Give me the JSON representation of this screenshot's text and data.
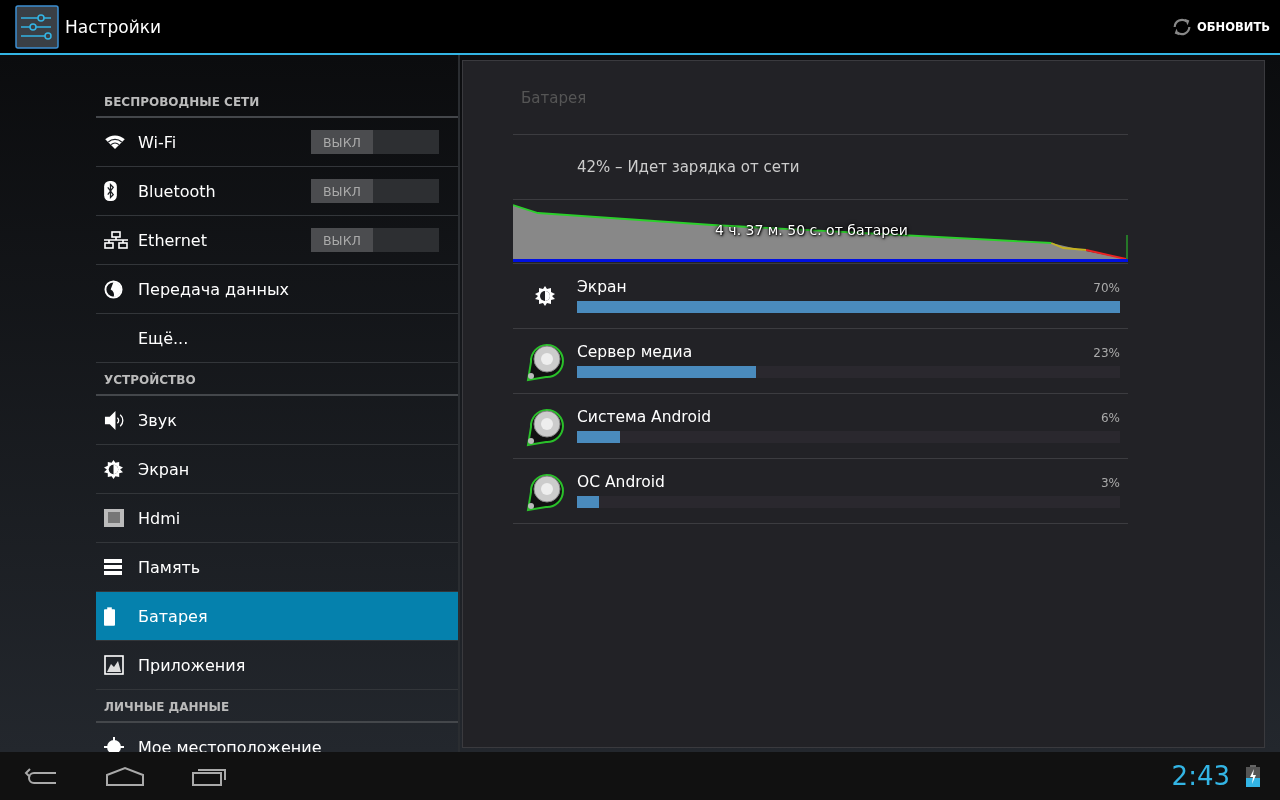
{
  "action_bar": {
    "title": "Настройки",
    "action": "ОБНОВИТЬ"
  },
  "sidebar": {
    "sections": [
      {
        "header": "БЕСПРОВОДНЫЕ СЕТИ",
        "items": [
          {
            "kind": "wifi",
            "label": "Wi-Fi",
            "selected": false,
            "toggle": {
              "label": "ВЫКЛ",
              "on": false
            }
          },
          {
            "kind": "bluetooth",
            "label": "Bluetooth",
            "selected": false,
            "toggle": {
              "label": "ВЫКЛ",
              "on": false
            }
          },
          {
            "kind": "ethernet",
            "label": "Ethernet",
            "selected": false,
            "toggle": {
              "label": "ВЫКЛ",
              "on": false
            }
          },
          {
            "kind": "data",
            "label": "Передача данных",
            "selected": false
          },
          {
            "kind": "none",
            "label": "Ещё...",
            "selected": false
          }
        ]
      },
      {
        "header": "УСТРОЙСТВО",
        "items": [
          {
            "kind": "sound",
            "label": "Звук",
            "selected": false
          },
          {
            "kind": "display",
            "label": "Экран",
            "selected": false
          },
          {
            "kind": "hdmi",
            "label": "Hdmi",
            "selected": false
          },
          {
            "kind": "storage",
            "label": "Память",
            "selected": false
          },
          {
            "kind": "battery",
            "label": "Батарея",
            "selected": true
          },
          {
            "kind": "apps",
            "label": "Приложения",
            "selected": false
          }
        ]
      },
      {
        "header": "ЛИЧНЫЕ ДАННЫЕ",
        "items": [
          {
            "kind": "location",
            "label": "Мое местоположение",
            "selected": false
          }
        ]
      }
    ]
  },
  "battery": {
    "title": "Батарея",
    "status": "42% – Идет зарядка от сети",
    "graph_label": "4 ч. 37 м. 50 с. от батареи",
    "usage": [
      {
        "kind": "display",
        "name": "Экран",
        "percent": "70%",
        "level": 1.0
      },
      {
        "kind": "app",
        "name": "Сервер медиа",
        "percent": "23%",
        "level": 0.33
      },
      {
        "kind": "app",
        "name": "Система Android",
        "percent": "6%",
        "level": 0.08
      },
      {
        "kind": "app",
        "name": "ОС Android",
        "percent": "3%",
        "level": 0.04
      }
    ]
  },
  "nav_bar": {
    "clock": "2:43"
  }
}
